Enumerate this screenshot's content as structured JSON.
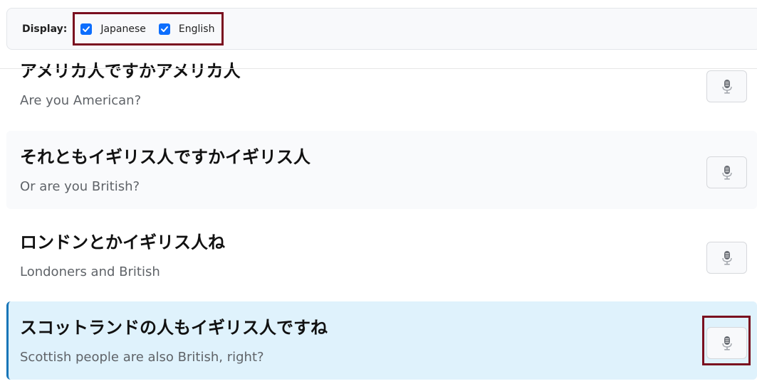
{
  "toolbar": {
    "label": "Display:",
    "options": [
      {
        "label": "Japanese",
        "checked": true
      },
      {
        "label": "English",
        "checked": true
      }
    ],
    "check_color": "#0d6efd",
    "highlight_color": "#7a0f1f"
  },
  "sentences": [
    {
      "jp": "アメリカ人ですかアメリカ人",
      "en": "Are you American?"
    },
    {
      "jp": "それともイギリス人ですかイギリス人",
      "en": "Or are you British?"
    },
    {
      "jp": "ロンドンとかイギリス人ね",
      "en": "Londoners and British"
    },
    {
      "jp": "スコットランドの人もイギリス人ですね",
      "en": "Scottish people are also British, right?"
    }
  ],
  "active_index": 3,
  "icons": {
    "play": "microphone-icon"
  }
}
